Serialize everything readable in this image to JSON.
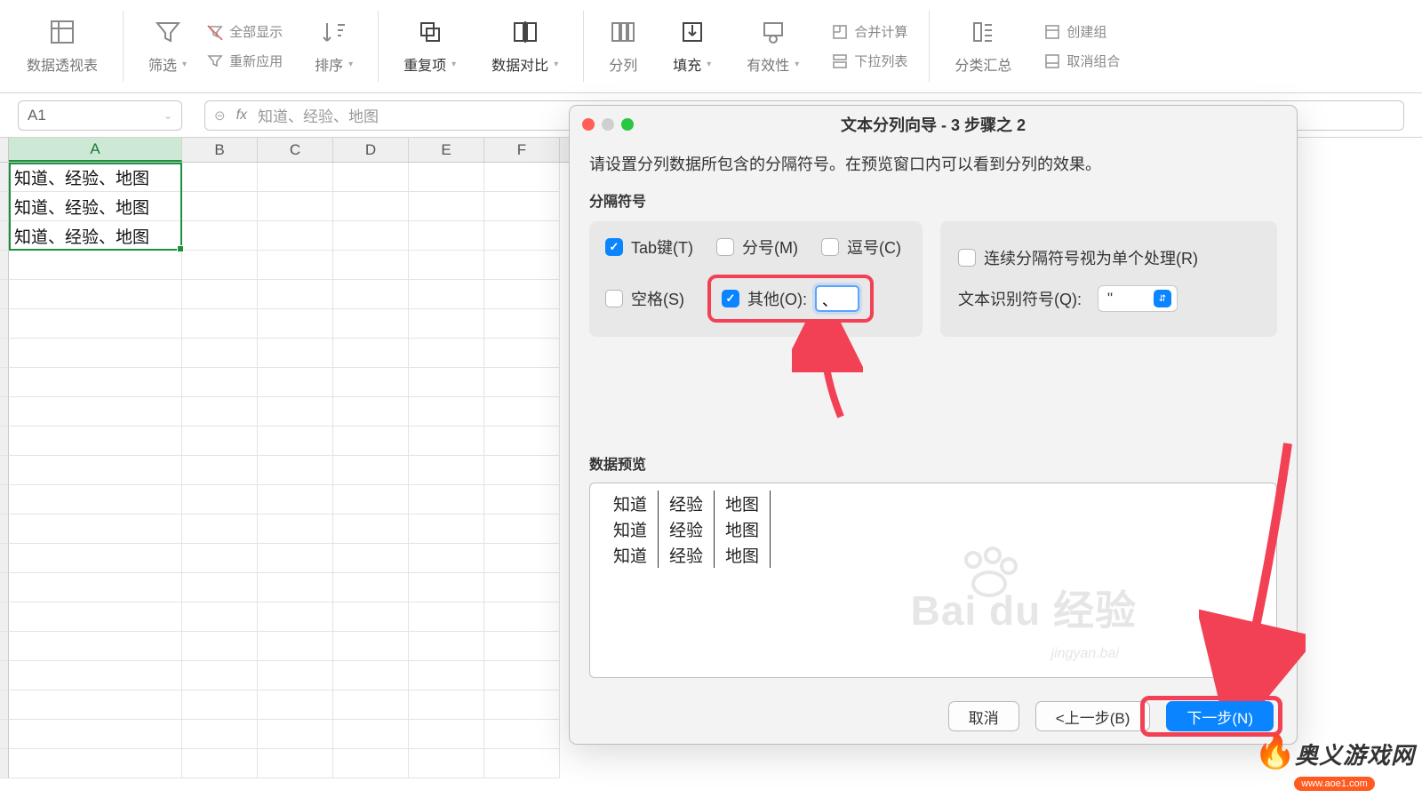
{
  "ribbon": {
    "pivot": "数据透视表",
    "filter": "筛选",
    "show_all": "全部显示",
    "reapply": "重新应用",
    "sort": "排序",
    "duplicates": "重复项",
    "compare": "数据对比",
    "split": "分列",
    "fill": "填充",
    "validation": "有效性",
    "consolidate": "合并计算",
    "dropdown_list": "下拉列表",
    "subtotal": "分类汇总",
    "group": "创建组",
    "ungroup": "取消组合"
  },
  "name_box": "A1",
  "formula_bar": "知道、经验、地图",
  "columns": [
    "A",
    "B",
    "C",
    "D",
    "E",
    "F"
  ],
  "cells": {
    "a1": "知道、经验、地图",
    "a2": "知道、经验、地图",
    "a3": "知道、经验、地图"
  },
  "dialog": {
    "title": "文本分列向导 - 3 步骤之 2",
    "desc": "请设置分列数据所包含的分隔符号。在预览窗口内可以看到分列的效果。",
    "delim_title": "分隔符号",
    "tab": "Tab键(T)",
    "semicolon": "分号(M)",
    "comma": "逗号(C)",
    "space": "空格(S)",
    "other": "其他(O):",
    "other_value": "、",
    "consec": "连续分隔符号视为单个处理(R)",
    "qualifier_label": "文本识别符号(Q):",
    "qualifier_value": "\"",
    "preview_title": "数据预览",
    "cancel": "取消",
    "back": "<上一步(B)",
    "next": "下一步(N)",
    "preview_rows": [
      [
        "知道",
        "经验",
        "地图"
      ],
      [
        "知道",
        "经验",
        "地图"
      ],
      [
        "知道",
        "经验",
        "地图"
      ]
    ]
  },
  "watermark": {
    "brand": "Bai du 经验",
    "sub": "jingyan.bai"
  },
  "site": {
    "name": "奥义游戏网",
    "domain": "www.aoe1.com"
  }
}
